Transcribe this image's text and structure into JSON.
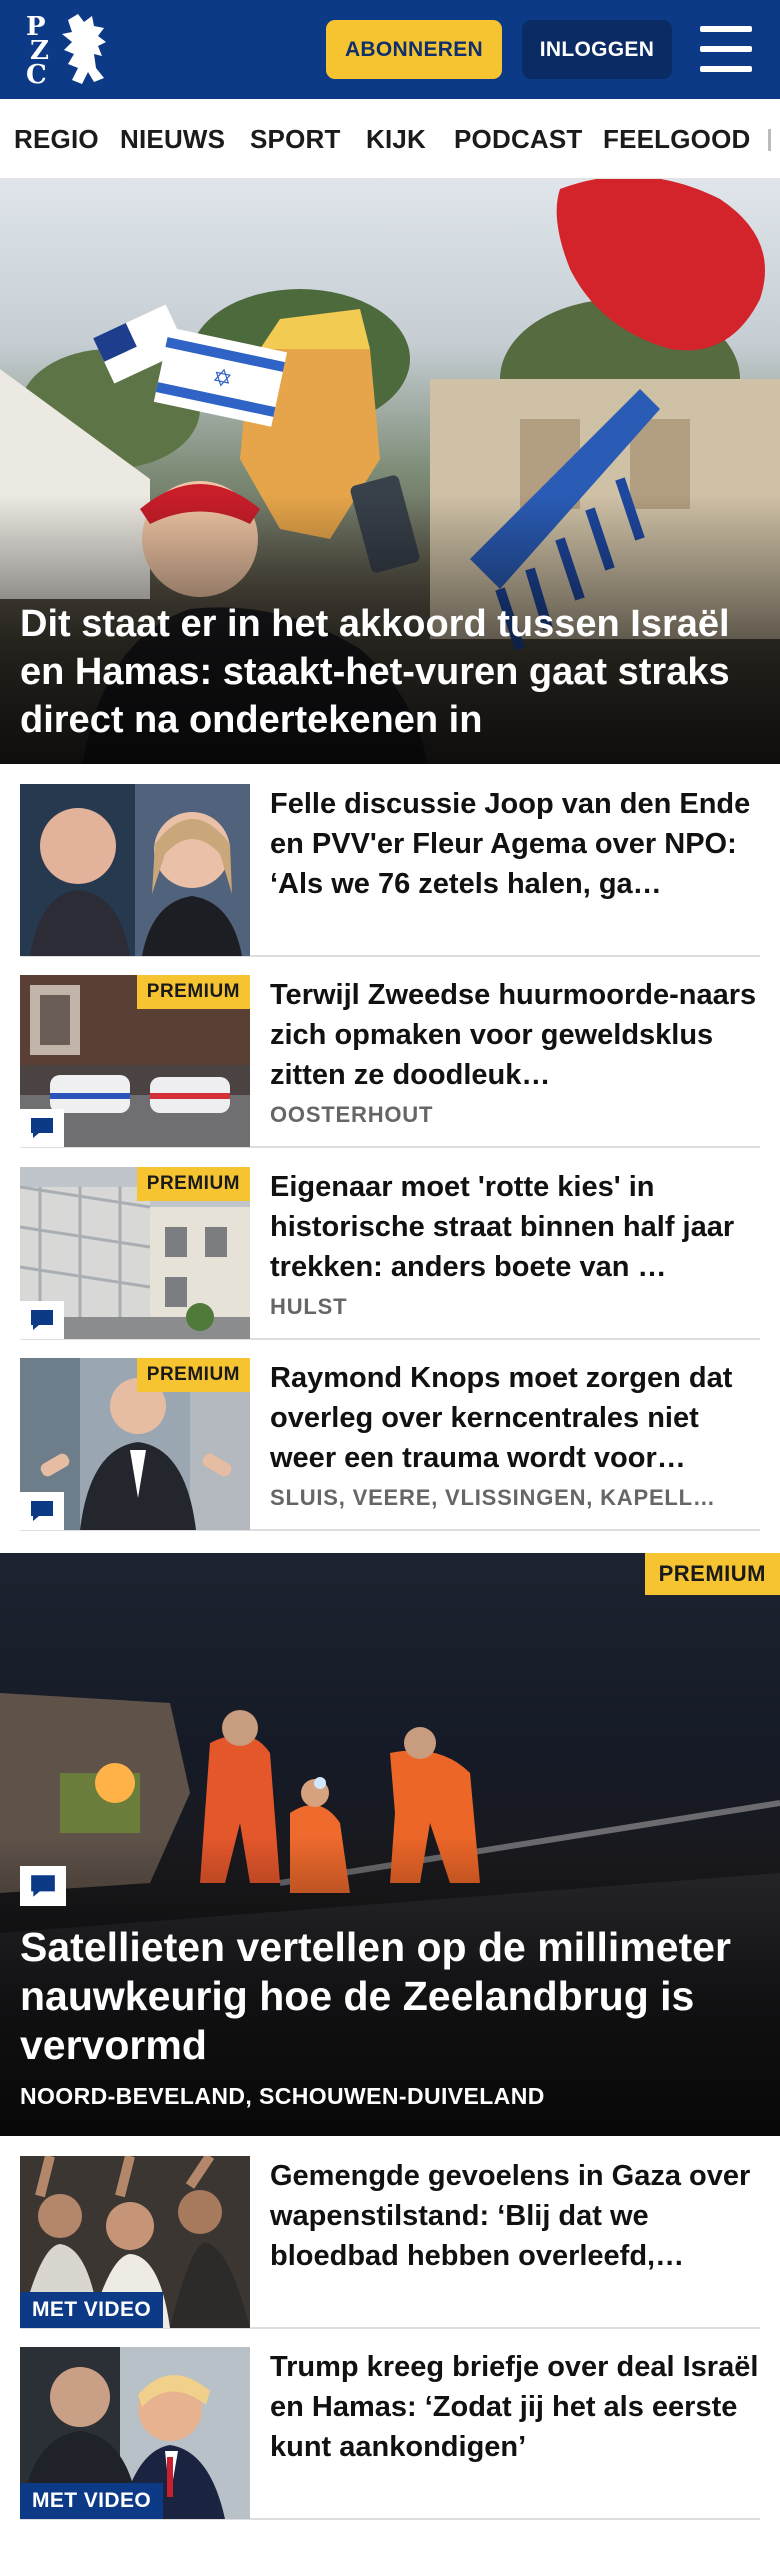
{
  "header": {
    "logo_letters": [
      "P",
      "Z",
      "C"
    ],
    "subscribe_label": "ABONNEREN",
    "login_label": "INLOGGEN",
    "menu_icon": "hamburger-menu-icon"
  },
  "nav": {
    "items": [
      "REGIO",
      "NIEUWS",
      "SPORT",
      "KIJK",
      "PODCAST",
      "FEELGOOD"
    ]
  },
  "hero": {
    "title": "Dit staat er in het akkoord tussen Israël en Hamas: staakt-het-vuren gaat straks direct na ondertekenen in"
  },
  "articles": [
    {
      "title": "Felle discussie Joop van den Ende en PVV'er Fleur Agema over NPO: ‘Als we 76 zetels halen, ga…",
      "location": "",
      "badge": "",
      "comments": false
    },
    {
      "title": "Terwijl Zweedse huurmoorde-naars zich opmaken voor geweldsklus zitten ze doodleuk…",
      "location": "OOSTERHOUT",
      "badge": "PREMIUM",
      "comments": true
    },
    {
      "title": "Eigenaar moet 'rotte kies' in historische straat binnen half jaar trekken: anders boete van …",
      "location": "HULST",
      "badge": "PREMIUM",
      "comments": true
    },
    {
      "title": "Raymond Knops moet zorgen dat overleg over kerncentrales niet weer een trauma wordt voor…",
      "location": "SLUIS, VEERE, VLISSINGEN, KAPELL…",
      "badge": "PREMIUM",
      "comments": true
    }
  ],
  "feature": {
    "badge": "PREMIUM",
    "title": "Satellieten vertellen op de millimeter nauwkeurig hoe de Zeelandbrug is vervormd",
    "location": "NOORD-BEVELAND, SCHOUWEN-DUIVELAND"
  },
  "video_articles": [
    {
      "title": "Gemengde gevoelens in Gaza over wapenstilstand: ‘Blij dat we bloedbad hebben overleefd,…",
      "badge": "MET VIDEO"
    },
    {
      "title": "Trump kreeg briefje over deal Israël en Hamas: ‘Zodat jij het als eerste kunt aankondigen’",
      "badge": "MET VIDEO"
    }
  ],
  "colors": {
    "brand_blue": "#0c3a86",
    "accent_yellow": "#f6c430"
  }
}
